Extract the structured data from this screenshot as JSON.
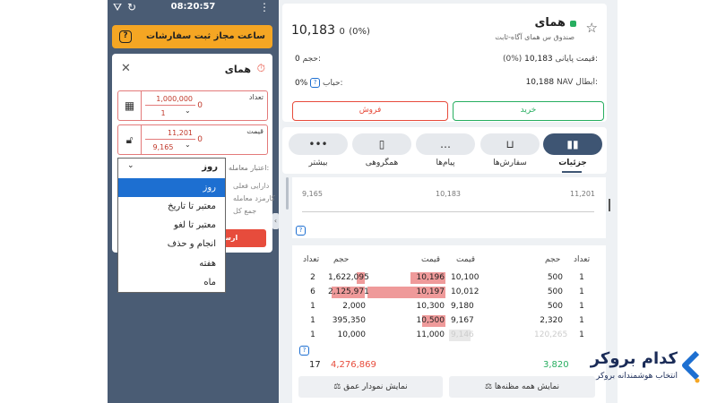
{
  "statusbar": {
    "time": "08:20:57"
  },
  "banner": {
    "text": "ساعت مجاز ثبت سفارشات",
    "help": "?"
  },
  "order": {
    "symbol": "همای",
    "qty_label": "تعداد",
    "qty_value": "1,000,000",
    "qty_min": "1",
    "qty_error": "0",
    "price_label": "قیمت",
    "price_max": "11,201",
    "price_min": "9,165",
    "price_error": "0",
    "validity_label": "اعتبار معامله:",
    "stub1": "دارایی فعلی",
    "stub2": "کارمزد معامله",
    "stub3": "جمع کل",
    "sell_stub": "ارسا"
  },
  "dropdown": {
    "selected": "روز",
    "options": [
      "روز",
      "معتبر تا تاریخ",
      "معتبر تا لغو",
      "انجام و حذف",
      "هفته",
      "ماه"
    ],
    "active_index": 0
  },
  "symbol_card": {
    "name": "همای",
    "subtitle": "صندوق س همای آگاه-ثابت",
    "last_price": "10,183",
    "change": "0",
    "change_pct": "(0%)",
    "close_label": "قیمت پایانی:",
    "close_value": "10,183",
    "close_pct": "(0%)",
    "volume_label": "حجم:",
    "volume_value": "0",
    "nav_label": "NAV ابطال:",
    "nav_value": "10,188",
    "bubble_label": "حباب:",
    "bubble_value": "0%",
    "buy_label": "خرید",
    "sell_label": "فروش"
  },
  "tabs": [
    {
      "label": "جزئیات",
      "icon": "chart-icon",
      "glyph": "▮▮"
    },
    {
      "label": "سفارش‌ها",
      "icon": "basket-icon",
      "glyph": "⊔"
    },
    {
      "label": "پیام‌ها",
      "icon": "message-icon",
      "glyph": "…"
    },
    {
      "label": "همگروهی",
      "icon": "group-icon",
      "glyph": "▯"
    },
    {
      "label": "بیشتر",
      "icon": "more-icon",
      "glyph": "•••"
    }
  ],
  "range": {
    "min": "9,165",
    "mid": "10,183",
    "max": "11,201"
  },
  "orderbook": {
    "headers": {
      "buy_count": "تعداد",
      "buy_volume": "حجم",
      "buy_price": "قیمت",
      "sell_price": "قیمت",
      "sell_volume": "حجم",
      "sell_count": "تعداد"
    },
    "rows": [
      {
        "bc": "1",
        "bv": "500",
        "bp": "10,100",
        "sp": "10,196",
        "sv": "1,622,095",
        "sc": "2"
      },
      {
        "bc": "1",
        "bv": "500",
        "bp": "10,012",
        "sp": "10,197",
        "sv": "2,125,971",
        "sc": "6"
      },
      {
        "bc": "1",
        "bv": "500",
        "bp": "9,180",
        "sp": "10,300",
        "sv": "2,000",
        "sc": "1"
      },
      {
        "bc": "1",
        "bv": "2,320",
        "bp": "9,167",
        "sp": "10,500",
        "sv": "395,350",
        "sc": "1"
      },
      {
        "bc": "1",
        "bv": "120,265",
        "bp": "9,146",
        "sp": "11,000",
        "sv": "10,000",
        "sc": "1"
      }
    ],
    "buy_total": "3,820",
    "sell_total": "4,276,869",
    "sell_count_total": "17",
    "all_quotes_btn": "نمایش همه مظنه‌ها",
    "depth_btn": "نمایش نمودار عمق"
  },
  "logo": {
    "main": "کدام بروکر",
    "sub": "انتخاب هوشمندانه بروکر"
  },
  "colors": {
    "buy": "#27ae60",
    "sell": "#e74c3c",
    "accent": "#1d6fd1",
    "banner": "#f5a623"
  }
}
